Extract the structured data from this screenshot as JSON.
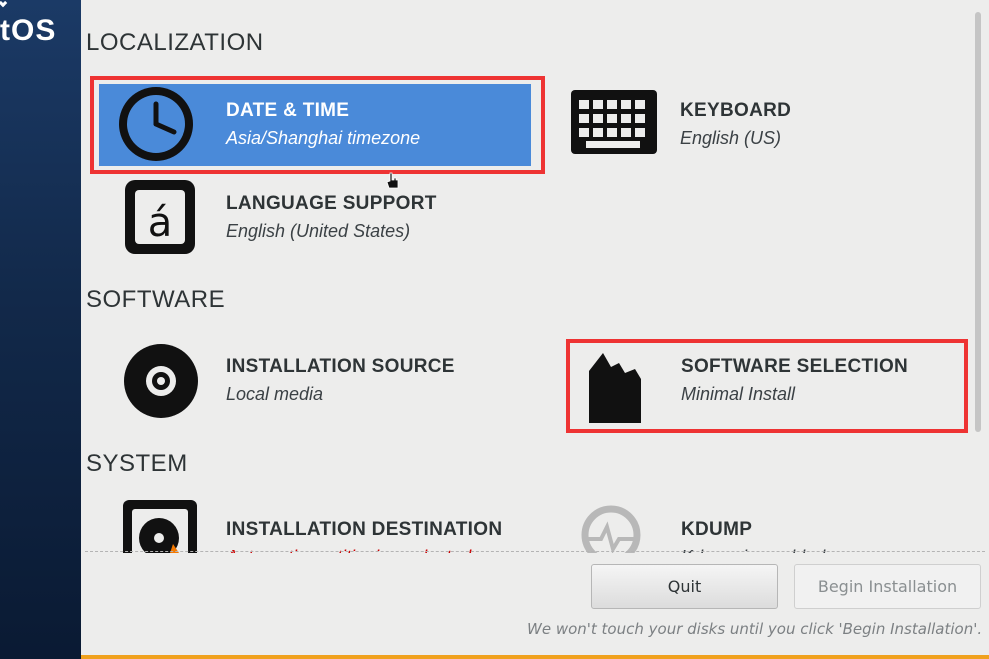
{
  "sidebar": {
    "logo_text": "tOS"
  },
  "sections": {
    "localization": "LOCALIZATION",
    "software": "SOFTWARE",
    "system": "SYSTEM"
  },
  "spokes": {
    "date_time": {
      "name": "DATE & TIME",
      "status": "Asia/Shanghai timezone",
      "icon": "clock-icon",
      "selected": true
    },
    "keyboard": {
      "name": "KEYBOARD",
      "status": "English (US)",
      "icon": "keyboard-icon"
    },
    "language_support": {
      "name": "LANGUAGE SUPPORT",
      "status": "English (United States)",
      "icon": "language-icon"
    },
    "installation_source": {
      "name": "INSTALLATION SOURCE",
      "status": "Local media",
      "icon": "disc-icon"
    },
    "software_selection": {
      "name": "SOFTWARE SELECTION",
      "status": "Minimal Install",
      "icon": "package-icon"
    },
    "installation_destination": {
      "name": "INSTALLATION DESTINATION",
      "status": "Automatic partitioning selected",
      "icon": "harddisk-icon",
      "status_color": "#cc0000"
    },
    "kdump": {
      "name": "KDUMP",
      "status": "Kdump is enabled",
      "icon": "kdump-icon"
    }
  },
  "buttons": {
    "quit": "Quit",
    "begin_installation": "Begin Installation"
  },
  "footer_note": "We won't touch your disks until you click 'Begin Installation'.",
  "colors": {
    "selected_spoke": "#4a8ad9",
    "highlight_box": "#ee3333",
    "accent_bar": "#f0a11d",
    "sidebar": "#12294a"
  }
}
